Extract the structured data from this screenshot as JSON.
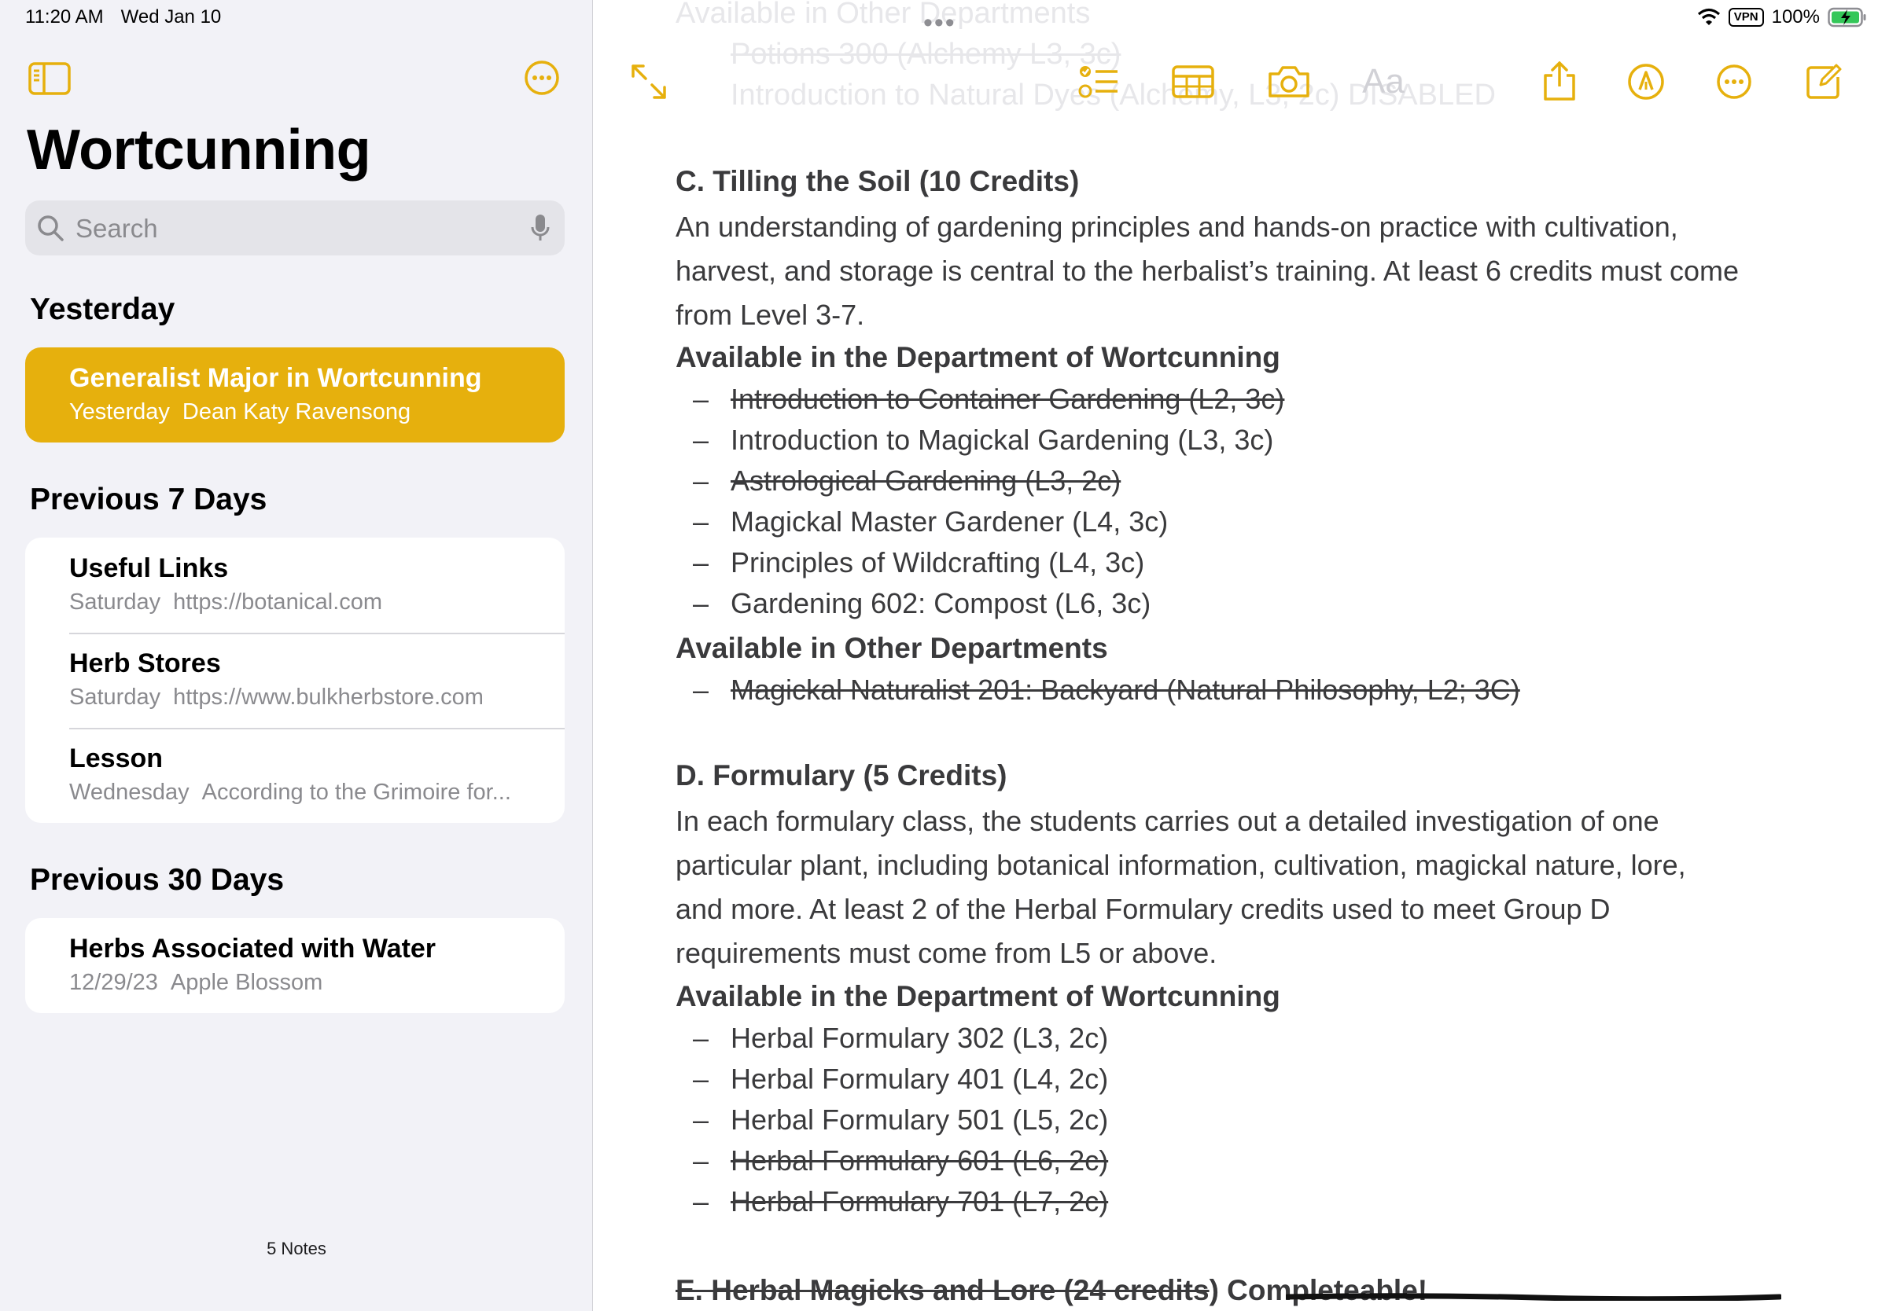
{
  "status_bar": {
    "time": "11:20 AM",
    "date": "Wed Jan 10",
    "vpn": "VPN",
    "battery": "100%"
  },
  "sidebar": {
    "folder_title": "Wortcunning",
    "search": {
      "placeholder": "Search"
    },
    "sections": [
      {
        "heading": "Yesterday",
        "notes": [
          {
            "title": "Generalist Major in Wortcunning",
            "date": "Yesterday",
            "preview": "Dean Katy Ravensong",
            "selected": true
          }
        ]
      },
      {
        "heading": "Previous 7 Days",
        "notes": [
          {
            "title": "Useful Links",
            "date": "Saturday",
            "preview": "https://botanical.com"
          },
          {
            "title": "Herb Stores",
            "date": "Saturday",
            "preview": "https://www.bulkherbstore.com"
          },
          {
            "title": "Lesson",
            "date": "Wednesday",
            "preview": "According to the Grimoire for..."
          }
        ]
      },
      {
        "heading": "Previous 30 Days",
        "notes": [
          {
            "title": "Herbs Associated with Water",
            "date": "12/29/23",
            "preview": "Apple Blossom"
          }
        ]
      }
    ],
    "notes_count": "5 Notes"
  },
  "toolbar": {
    "format_label": "Aa",
    "multitasking": "•••"
  },
  "colors": {
    "accent": "#e6b00d",
    "sidebar_bg": "#f2f2f7",
    "body_text": "#3a3a3c"
  },
  "note": {
    "faded_top": [
      "Available in Other Departments",
      "Potions 300 (Alchemy L3, 3c)",
      "Introduction to Natural Dyes (Alchemy, L3, 2c) DISABLED"
    ],
    "section_c": {
      "heading": "C. Tilling the Soil (10 Credits)",
      "paragraph": [
        "An understanding of gardening principles and hands-on practice with cultivation,",
        "harvest, and storage is central to the herbalist’s training. At least 6 credits must come",
        "from Level 3-7."
      ],
      "dept_heading": "Available in the Department of Wortcunning",
      "dept_items": [
        {
          "text": "Introduction to Container Gardening (L2, 3c)",
          "done": true
        },
        {
          "text": "Introduction to Magickal Gardening (L3, 3c)",
          "done": false
        },
        {
          "text": "Astrological Gardening (L3, 2c)",
          "done": true
        },
        {
          "text": "Magickal Master Gardener (L4, 3c)",
          "done": false
        },
        {
          "text": "Principles of Wildcrafting (L4, 3c)",
          "done": false
        },
        {
          "text": "Gardening 602: Compost (L6, 3c)",
          "done": false
        }
      ],
      "other_heading": "Available in Other Departments",
      "other_items": [
        {
          "text": "Magickal Naturalist 201: Backyard (Natural Philosophy, L2; 3C)",
          "done": true
        }
      ]
    },
    "section_d": {
      "heading": "D. Formulary (5 Credits)",
      "paragraph": [
        "In each formulary class, the students carries out a detailed investigation of one",
        "particular plant, including botanical information, cultivation, magickal nature, lore,",
        "and more. At least 2 of the Herbal Formulary credits used to meet Group D",
        "requirements must come from L5 or above."
      ],
      "dept_heading": "Available in the Department of Wortcunning",
      "dept_items": [
        {
          "text": "Herbal Formulary 302 (L3, 2c)",
          "done": false
        },
        {
          "text": "Herbal Formulary 401 (L4, 2c)",
          "done": false
        },
        {
          "text": "Herbal Formulary 501 (L5, 2c)",
          "done": false
        },
        {
          "text": "Herbal Formulary 601 (L6, 2c)",
          "done": true
        },
        {
          "text": "Herbal Formulary 701 (L7, 2c)",
          "done": true
        }
      ]
    },
    "section_e": {
      "heading_struck": "E. Herbal Magicks and Lore (24 credits",
      "heading_rest": ") Completeable!"
    }
  }
}
